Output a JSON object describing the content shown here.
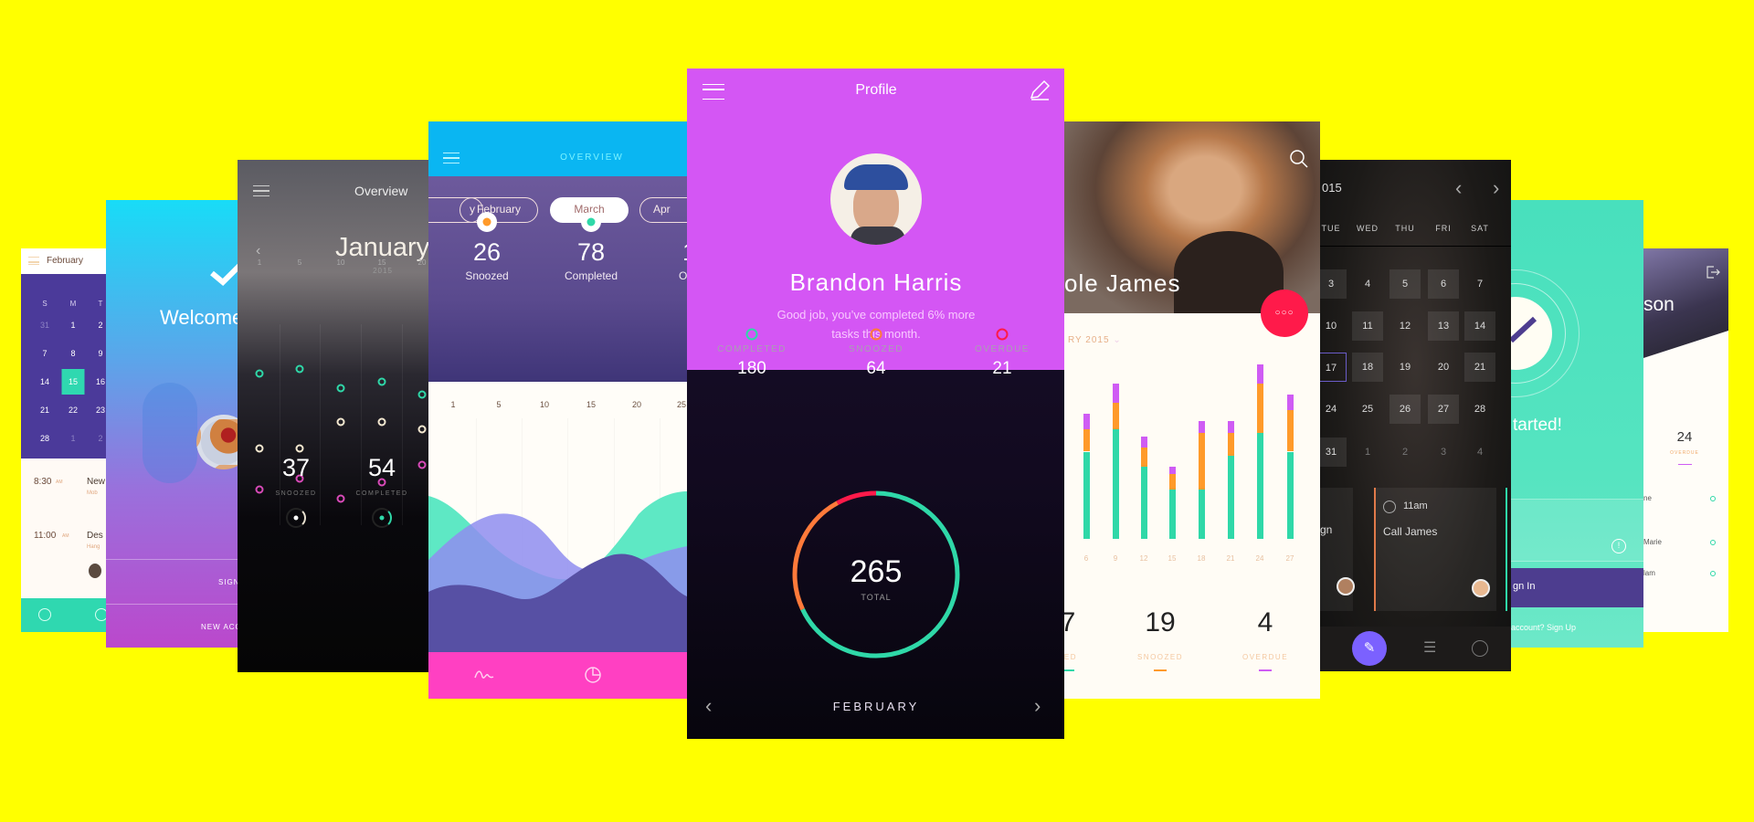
{
  "colors": {
    "background": "#ffff00",
    "profile_purple": "#d456f4",
    "teal": "#2fd8a8",
    "orange": "#ff9a2a",
    "overdue": "#ff1a4a",
    "magenta": "#ff40c0",
    "violet": "#cf5cf4"
  },
  "phone_calendar": {
    "month": "February",
    "weekdays": [
      "S",
      "M",
      "T"
    ],
    "rows": [
      [
        "31",
        "1",
        "2"
      ],
      [
        "7",
        "8",
        "9"
      ],
      [
        "14",
        "15",
        "16"
      ],
      [
        "21",
        "22",
        "23"
      ],
      [
        "28",
        "1",
        "2"
      ]
    ],
    "selected": "15",
    "events": [
      {
        "time": "8:30",
        "ampm": "AM",
        "title": "New",
        "sub": "Mob"
      },
      {
        "time": "11:00",
        "ampm": "AM",
        "title": "Des",
        "sub": "Hang"
      }
    ],
    "icons": [
      "check-circle-icon",
      "add-circle-icon"
    ]
  },
  "phone_welcome": {
    "title": "Welcome",
    "sign_in": "SIGN",
    "new_account": "NEW ACC",
    "icon": "checkmark-icon"
  },
  "phone_overview_dark": {
    "title": "Overview",
    "month": "January",
    "year": "2015",
    "days": [
      "1",
      "5",
      "10",
      "15",
      "20"
    ],
    "stats": [
      {
        "value": "37",
        "label": "SNOOZED"
      },
      {
        "value": "54",
        "label": "COMPLETED"
      }
    ]
  },
  "phone_overview_blue": {
    "title": "OVERVIEW",
    "months": [
      "y",
      "February",
      "March",
      "Apr"
    ],
    "selected_month": "March",
    "stats": [
      {
        "value": "26",
        "label": "Snoozed",
        "color": "#ff9a2a"
      },
      {
        "value": "78",
        "label": "Completed",
        "color": "#2fd8a8"
      },
      {
        "value": "1",
        "label": "Ov"
      }
    ],
    "days": [
      "1",
      "5",
      "10",
      "15",
      "20",
      "25"
    ],
    "nav_icons": [
      "wave-chart-icon",
      "pie-chart-icon"
    ]
  },
  "phone_profile": {
    "title": "Profile",
    "name": "Brandon Harris",
    "subtitle_line1": "Good job, you’ve completed 6% more",
    "subtitle_line2": "tasks this month.",
    "stats": [
      {
        "label": "COMPLETED",
        "value": 180,
        "color": "#2fd8a8"
      },
      {
        "label": "SNOOZED",
        "value": 64,
        "color": "#ff7a3a"
      },
      {
        "label": "OVERDUE",
        "value": 21,
        "color": "#ff1a4a"
      }
    ],
    "total": "265",
    "total_label": "TOTAL",
    "month": "FEBRUARY"
  },
  "phone_stats": {
    "name": "ole James",
    "period": "RY 2015",
    "chart_data": {
      "type": "bar",
      "stacked": true,
      "categories": [
        "6",
        "9",
        "12",
        "15",
        "18",
        "21",
        "24",
        "27"
      ],
      "series": [
        {
          "color": "#2fd8a8",
          "values": [
            23,
            29,
            19,
            13,
            13,
            22,
            28,
            23
          ]
        },
        {
          "color": "#ff9a2a",
          "values": [
            6,
            7,
            5,
            4,
            15,
            6,
            13,
            11
          ]
        },
        {
          "color": "#cf5cf4",
          "values": [
            4,
            5,
            3,
            2,
            3,
            3,
            5,
            4
          ]
        }
      ]
    },
    "summary": [
      {
        "value": "7",
        "label": "LETED",
        "color": "#2fd8a8"
      },
      {
        "value": "19",
        "label": "SNOOZED",
        "color": "#ff9a2a"
      },
      {
        "value": "4",
        "label": "OVERDUE",
        "color": "#cf5cf4"
      }
    ]
  },
  "phone_dark_calendar": {
    "year": "015",
    "weekdays": [
      "TUE",
      "WED",
      "THU",
      "FRI",
      "SAT"
    ],
    "rows": [
      [
        "3",
        "4",
        "5",
        "6",
        "7"
      ],
      [
        "10",
        "11",
        "12",
        "13",
        "14"
      ],
      [
        "17",
        "18",
        "19",
        "20",
        "21"
      ],
      [
        "24",
        "25",
        "26",
        "27",
        "28"
      ],
      [
        "31",
        "1",
        "2",
        "3",
        "4"
      ]
    ],
    "boxed": [
      "3",
      "5",
      "6",
      "11",
      "13",
      "14",
      "18",
      "21",
      "26",
      "27",
      "31"
    ],
    "outlined": "17",
    "dim_row": 4,
    "cards": [
      {
        "time": "",
        "title": "gn"
      },
      {
        "time": "11am",
        "title": "Call James"
      }
    ]
  },
  "phone_get_started": {
    "title": "tarted!",
    "button": "gn In",
    "footer": "account? Sign Up"
  },
  "phone_list": {
    "name": "son",
    "stat_value": "24",
    "stat_label": "OVERDUE",
    "items": [
      "ne",
      "Marie",
      "lam"
    ]
  }
}
